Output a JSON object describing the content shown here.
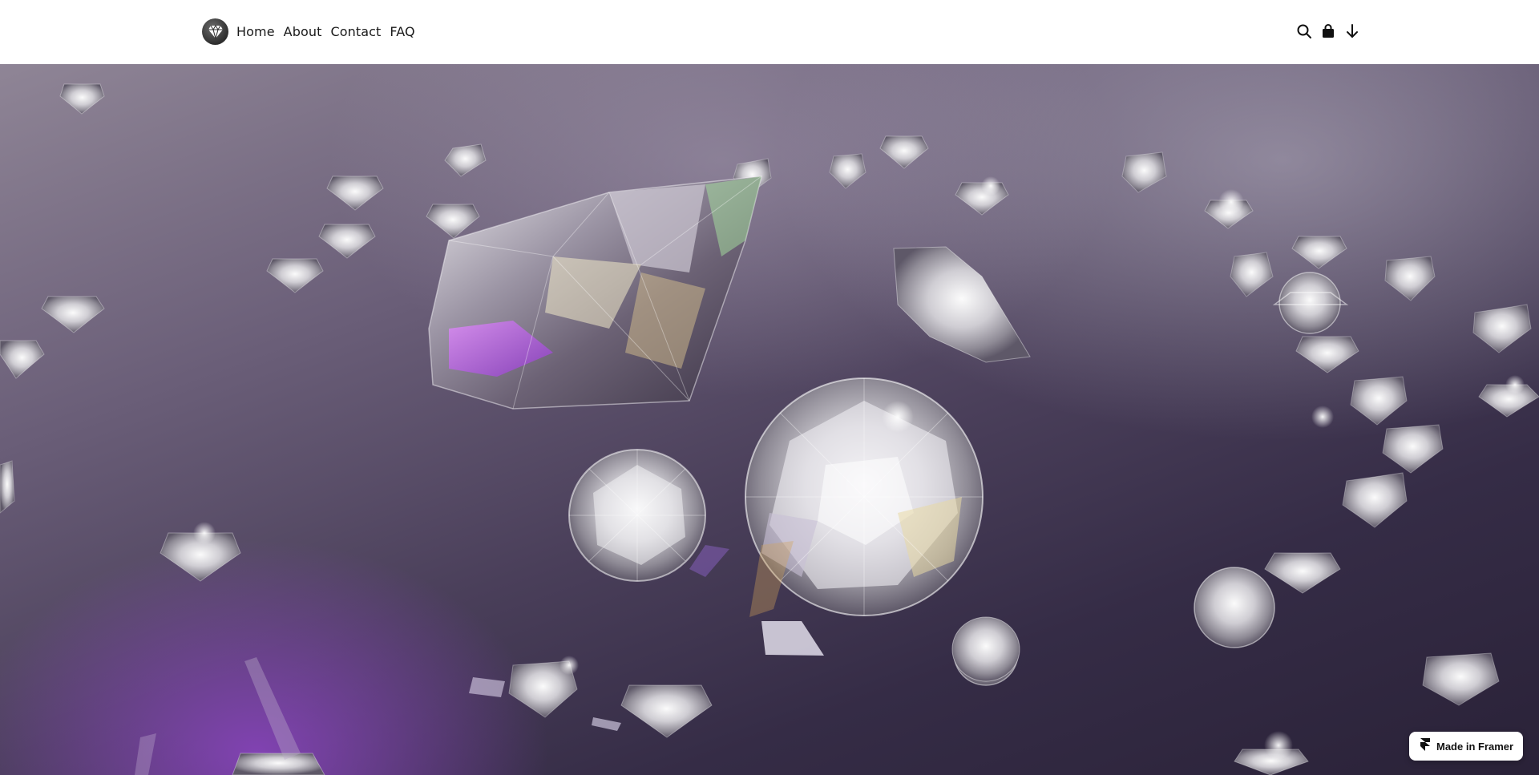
{
  "nav": {
    "logo_icon": "diamond-logo-icon",
    "links": [
      {
        "label": "Home"
      },
      {
        "label": "About"
      },
      {
        "label": "Contact"
      },
      {
        "label": "FAQ"
      }
    ],
    "icons": [
      "search-icon",
      "shopping-bag-icon",
      "arrow-down-icon"
    ]
  },
  "hero": {
    "image": "diamonds-on-purple-surface",
    "accent_color": "#8a4fc4"
  },
  "badge": {
    "label": "Made in Framer",
    "icon": "framer-icon"
  }
}
